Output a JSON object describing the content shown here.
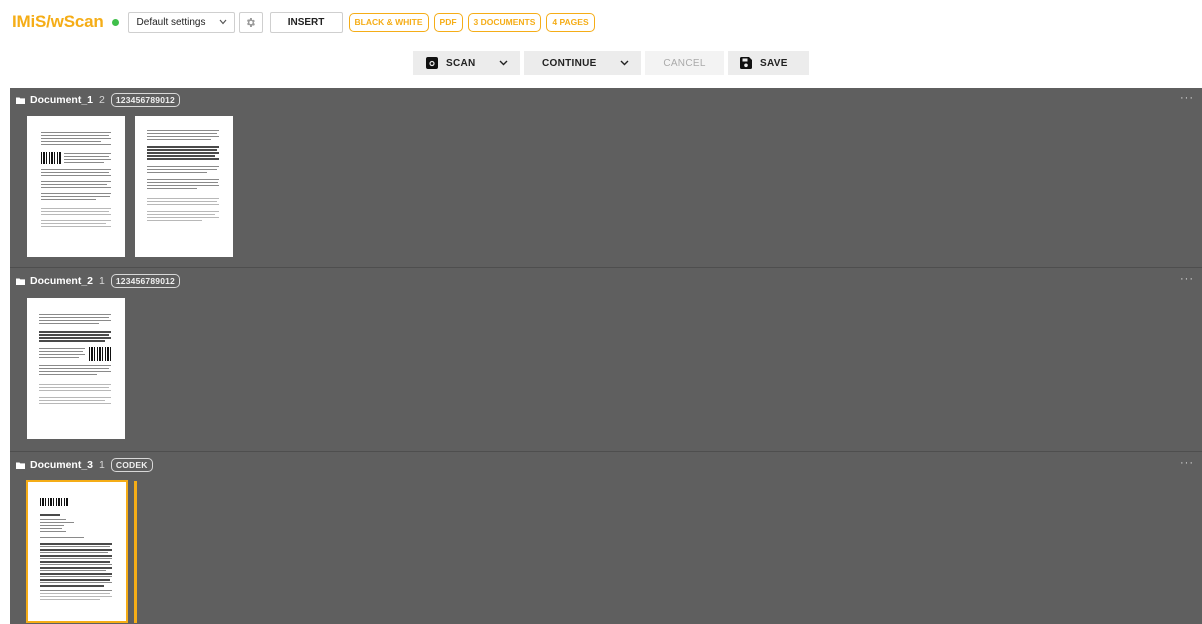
{
  "app": {
    "title": "IMiS/wScan",
    "status_color": "#3fbf4a",
    "accent_color": "#f5ad17"
  },
  "toolbar": {
    "settings_value": "Default settings",
    "insert_label": "INSERT",
    "chips": [
      "BLACK & WHITE",
      "PDF",
      "3 DOCUMENTS",
      "4 PAGES"
    ]
  },
  "actions": {
    "scan_label": "SCAN",
    "continue_label": "CONTINUE",
    "cancel_label": "CANCEL",
    "save_label": "SAVE"
  },
  "documents": [
    {
      "name": "Document_1",
      "page_count": "2",
      "badge": "123456789012",
      "more": "···"
    },
    {
      "name": "Document_2",
      "page_count": "1",
      "badge": "123456789012",
      "more": "···"
    },
    {
      "name": "Document_3",
      "page_count": "1",
      "badge": "CODEK",
      "more": "···"
    }
  ],
  "icons": {
    "status": "status-dot",
    "settings_caret": "chevron-down-icon",
    "gear": "gear-icon",
    "scan": "camera-icon",
    "save": "floppy-disk-icon",
    "folder": "folder-icon",
    "more": "more-horizontal-icon"
  }
}
